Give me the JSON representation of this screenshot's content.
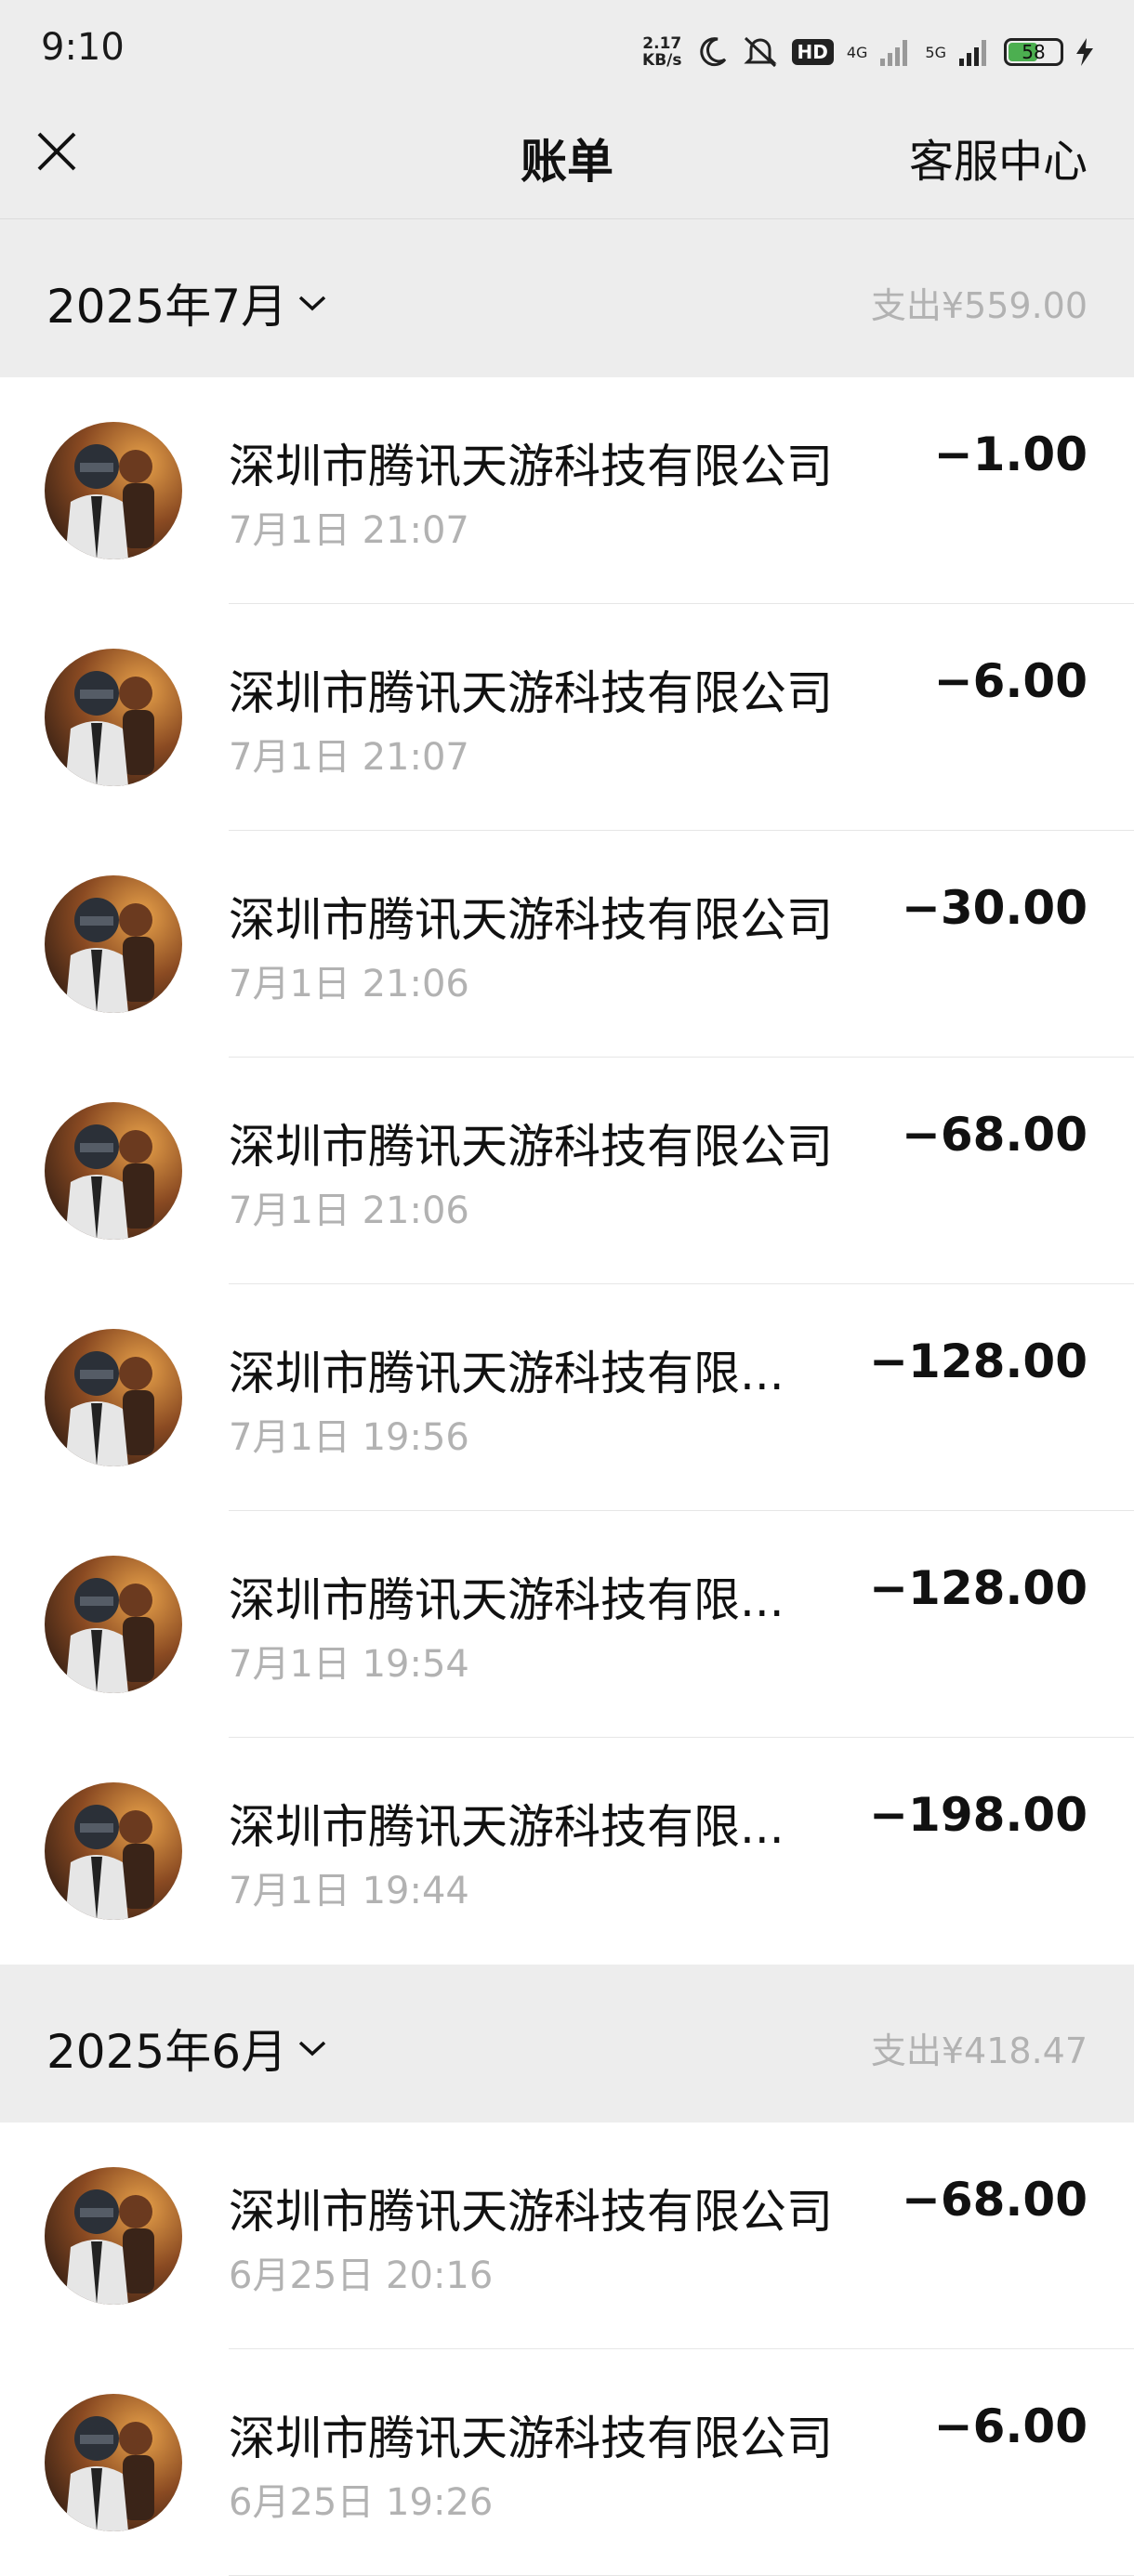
{
  "status_bar": {
    "time": "9:10",
    "net_speed_value": "2.17",
    "net_speed_unit": "KB/s",
    "hd_label": "HD",
    "net1": "4G",
    "net2": "5G",
    "battery_percent": 58,
    "battery_text": "58",
    "icons": [
      "moon-icon",
      "mute-bell-icon",
      "signal-icon",
      "charging-icon"
    ]
  },
  "nav": {
    "title": "账单",
    "right_link": "客服中心",
    "close_icon": "close-icon"
  },
  "months": [
    {
      "label": "2025年7月",
      "total": "支出¥559.00",
      "transactions": [
        {
          "name": "深圳市腾讯天游科技有限公司",
          "time": "7月1日 21:07",
          "amount": "−1.00"
        },
        {
          "name": "深圳市腾讯天游科技有限公司",
          "time": "7月1日 21:07",
          "amount": "−6.00"
        },
        {
          "name": "深圳市腾讯天游科技有限公司",
          "time": "7月1日 21:06",
          "amount": "−30.00"
        },
        {
          "name": "深圳市腾讯天游科技有限公司",
          "time": "7月1日 21:06",
          "amount": "−68.00"
        },
        {
          "name": "深圳市腾讯天游科技有限...",
          "time": "7月1日 19:56",
          "amount": "−128.00"
        },
        {
          "name": "深圳市腾讯天游科技有限...",
          "time": "7月1日 19:54",
          "amount": "−128.00"
        },
        {
          "name": "深圳市腾讯天游科技有限...",
          "time": "7月1日 19:44",
          "amount": "−198.00"
        }
      ]
    },
    {
      "label": "2025年6月",
      "total": "支出¥418.47",
      "transactions": [
        {
          "name": "深圳市腾讯天游科技有限公司",
          "time": "6月25日 20:16",
          "amount": "−68.00"
        },
        {
          "name": "深圳市腾讯天游科技有限公司",
          "time": "6月25日 19:26",
          "amount": "−6.00"
        }
      ]
    }
  ],
  "colors": {
    "page_bg": "#ededed",
    "row_bg": "#ffffff",
    "primary_text": "#111111",
    "secondary_text": "#b2b2b2"
  }
}
